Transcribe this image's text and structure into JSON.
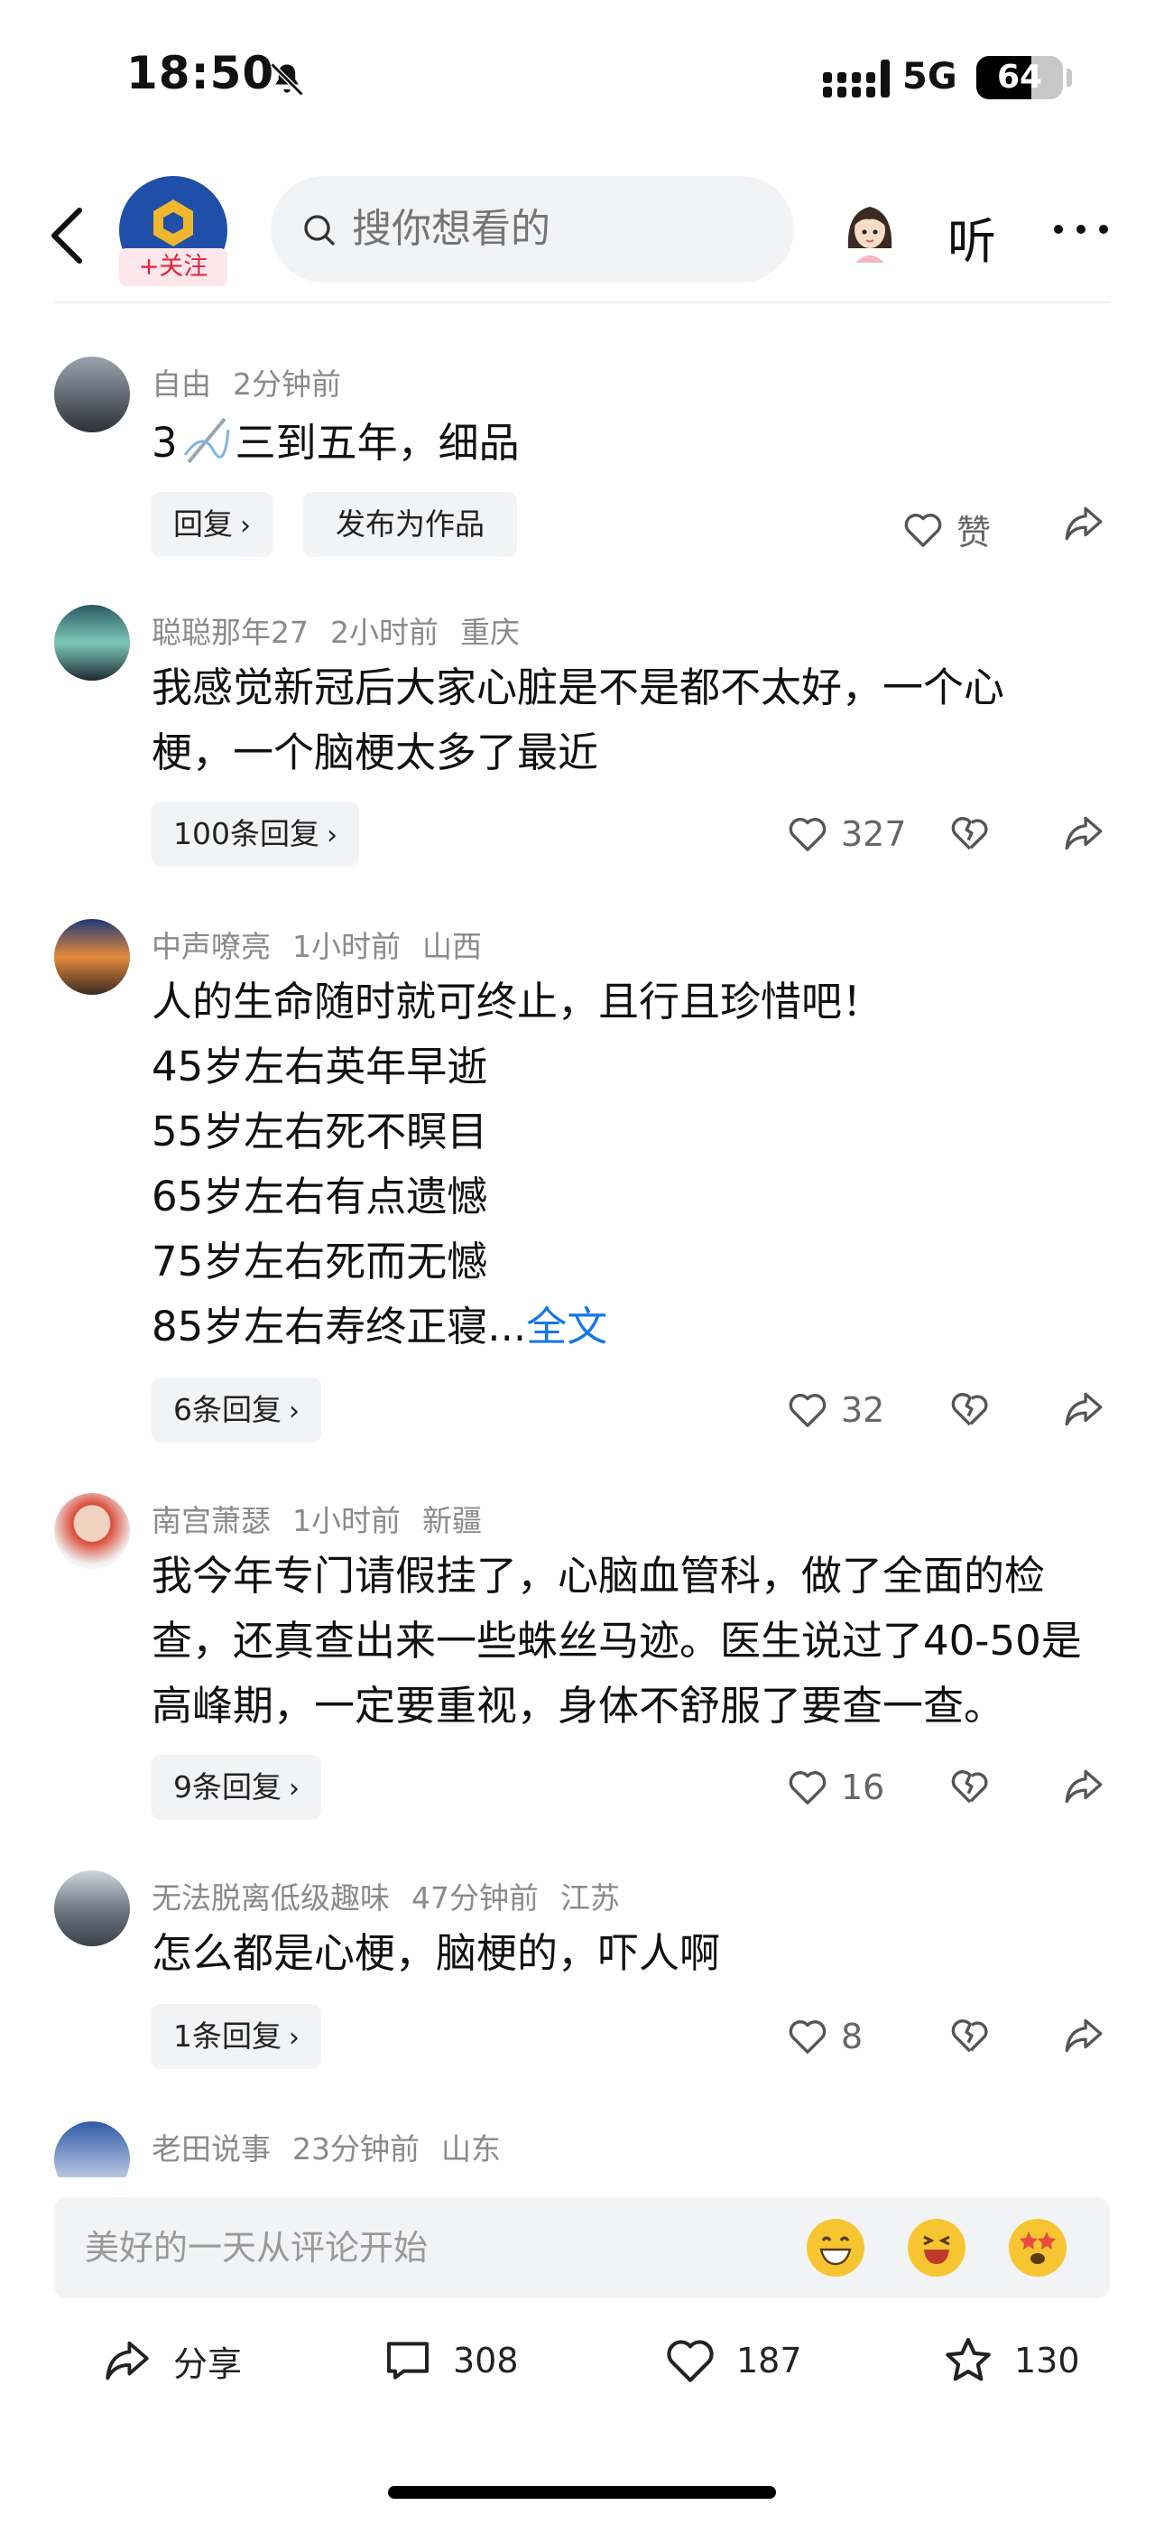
{
  "status_bar": {
    "time": "18:50",
    "network": "5G",
    "battery": "64",
    "battery_level": 0.64
  },
  "nav": {
    "follow_label": "+关注",
    "search_placeholder": "搜你想看的",
    "listen_label": "听"
  },
  "comments": [
    {
      "user": "自由",
      "time": "2分钟前",
      "location": "",
      "text_prefix": "3",
      "text": "三到五年，细品",
      "reply_label": "回复",
      "publish_label": "发布为作品",
      "like_label": "赞",
      "avatar_color": "#3a3f47"
    },
    {
      "user": "聪聪那年27",
      "time": "2小时前",
      "location": "重庆",
      "text": "我感觉新冠后大家心脏是不是都不太好，一个心梗，一个脑梗太多了最近",
      "reply_label": "100条回复",
      "likes": "327",
      "avatar_color": "#3d7a73"
    },
    {
      "user": "中声嘹亮",
      "time": "1小时前",
      "location": "山西",
      "lines": [
        "人的生命随时就可终止，且行且珍惜吧！",
        "45岁左右英年早逝",
        "55岁左右死不瞑目",
        "65岁左右有点遗憾",
        "75岁左右死而无憾",
        "85岁左右寿终正寝..."
      ],
      "more_label": "全文",
      "reply_label": "6条回复",
      "likes": "32",
      "avatar_color": "#c76a2b"
    },
    {
      "user": "南宫萧瑟",
      "time": "1小时前",
      "location": "新疆",
      "text": "我今年专门请假挂了，心脑血管科，做了全面的检查，还真查出来一些蛛丝马迹。医生说过了40-50是高峰期，一定要重视，身体不舒服了要查一查。",
      "reply_label": "9条回复",
      "likes": "16",
      "avatar_color": "#d94a3a"
    },
    {
      "user": "无法脱离低级趣味",
      "time": "47分钟前",
      "location": "江苏",
      "text": "怎么都是心梗，脑梗的，吓人啊",
      "reply_label": "1条回复",
      "likes": "8",
      "avatar_color": "#6f7a84"
    },
    {
      "user": "老田说事",
      "time": "23分钟前",
      "location": "山东",
      "avatar_color": "#2f5aa8"
    }
  ],
  "comment_input": {
    "placeholder": "美好的一天从评论开始"
  },
  "bottom_bar": {
    "share_label": "分享",
    "comments_count": "308",
    "likes_count": "187",
    "favorites_count": "130"
  },
  "colors": {
    "accent_blue": "#1677e5",
    "follow_red": "#e5223b",
    "logo_blue": "#1f4fa8"
  }
}
